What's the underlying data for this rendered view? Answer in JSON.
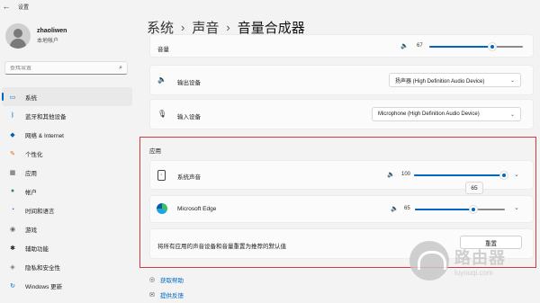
{
  "window": {
    "title": "设置"
  },
  "user": {
    "name": "zhaoliwen",
    "account": "本地帐户"
  },
  "search": {
    "placeholder": "查找设置"
  },
  "nav": {
    "items": [
      {
        "label": "系统",
        "icon": "monitor-icon",
        "glyph": "▭",
        "color": "#0067c0"
      },
      {
        "label": "蓝牙和其他设备",
        "icon": "bluetooth-icon",
        "glyph": "ᛒ",
        "color": "#0067c0"
      },
      {
        "label": "网络 & Internet",
        "icon": "wifi-icon",
        "glyph": "◆",
        "color": "#0a5ca8"
      },
      {
        "label": "个性化",
        "icon": "brush-icon",
        "glyph": "✎",
        "color": "#d36b1e"
      },
      {
        "label": "应用",
        "icon": "apps-icon",
        "glyph": "▦",
        "color": "#555555"
      },
      {
        "label": "帐户",
        "icon": "person-icon",
        "glyph": "●",
        "color": "#2c8f5a"
      },
      {
        "label": "时间和语言",
        "icon": "globe-clock-icon",
        "glyph": "◔",
        "color": "#0067c0"
      },
      {
        "label": "游戏",
        "icon": "gamepad-icon",
        "glyph": "◉",
        "color": "#666666"
      },
      {
        "label": "辅助功能",
        "icon": "accessibility-icon",
        "glyph": "✱",
        "color": "#222222"
      },
      {
        "label": "隐私和安全性",
        "icon": "shield-icon",
        "glyph": "◈",
        "color": "#777777"
      },
      {
        "label": "Windows 更新",
        "icon": "update-icon",
        "glyph": "↻",
        "color": "#0067c0"
      }
    ],
    "active_index": 0
  },
  "breadcrumb": {
    "part1": "系统",
    "part2": "声音",
    "current": "音量合成器",
    "separator": "›"
  },
  "master": {
    "label": "音量",
    "value": "67",
    "level": 0.67
  },
  "output_device": {
    "label": "输出设备",
    "value": "扬声器 (High Definition Audio Device)"
  },
  "input_device": {
    "label": "输入设备",
    "value": "Microphone (High Definition Audio Device)"
  },
  "apps_section": {
    "title": "应用",
    "apps": [
      {
        "name": "系统声音",
        "volume": "100",
        "level": 1.0
      },
      {
        "name": "Microsoft Edge",
        "volume": "65",
        "level": 0.65
      }
    ],
    "tooltip": "65",
    "reset_text": "将所有应用的声音设备和音量重置为推荐的默认值",
    "reset_button": "重置"
  },
  "links": {
    "help": "获取帮助",
    "feedback": "提供反馈"
  },
  "watermark": {
    "title": "路由器",
    "subtitle": "luyouqi.com"
  },
  "colors": {
    "accent": "#0067c0",
    "highlight_border": "#d9363e"
  }
}
